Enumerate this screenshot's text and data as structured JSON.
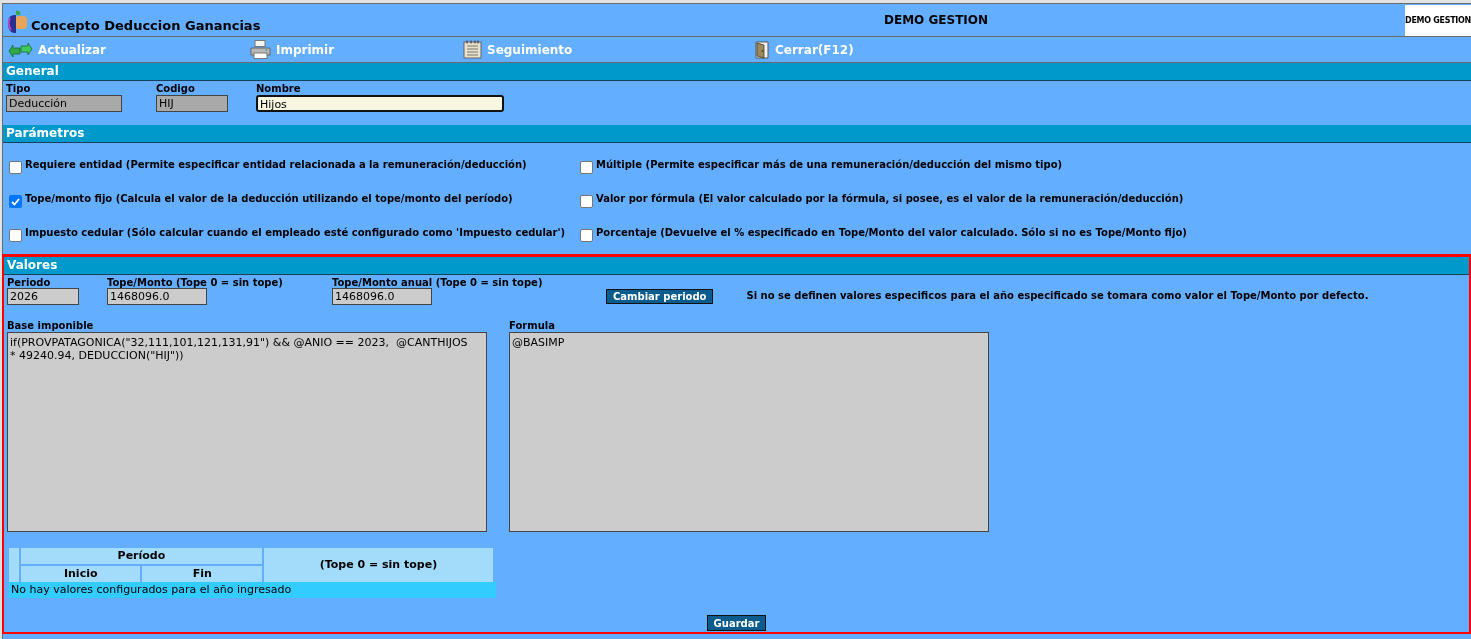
{
  "window": {
    "title": "Concepto Deduccion Ganancias",
    "company": "DEMO GESTION",
    "logo_text": "DEMO GESTION"
  },
  "toolbar": [
    {
      "label": "Actualizar"
    },
    {
      "label": "Imprimir"
    },
    {
      "label": "Seguimiento"
    },
    {
      "label": "Cerrar(F12)"
    }
  ],
  "general": {
    "title": "General",
    "fields": [
      {
        "label": "Tipo",
        "value": "Deducción",
        "disabled": true
      },
      {
        "label": "Codigo",
        "value": "HIJ",
        "disabled": true
      },
      {
        "label": "Nombre",
        "value": "Hijos",
        "disabled": false
      }
    ]
  },
  "parametros": {
    "title": "Parámetros",
    "options": [
      {
        "label": "Requiere entidad (Permite especificar entidad relacionada a la remuneración/deducción)",
        "checked": false
      },
      {
        "label": "Múltiple (Permite especificar más de una remuneración/deducción del mismo tipo)",
        "checked": false
      },
      {
        "label": "Tope/monto fijo (Calcula el valor de la deducción utilizando el tope/monto del período)",
        "checked": true
      },
      {
        "label": "Valor por fórmula (El valor calculado por la fórmula, si posee, es el valor de la remuneración/deducción)",
        "checked": false
      },
      {
        "label": "Impuesto cedular (Sólo calcular cuando el empleado esté configurado como 'Impuesto cedular')",
        "checked": false
      },
      {
        "label": "Porcentaje (Devuelve el % especificado en Tope/Monto del valor calculado. Sólo si no es Tope/Monto fijo)",
        "checked": false
      }
    ]
  },
  "valores": {
    "title": "Valores",
    "fields": [
      {
        "label": "Periodo",
        "value": "2026"
      },
      {
        "label": "Tope/Monto (Tope 0 = sin tope)",
        "value": "1468096.0"
      },
      {
        "label": "Tope/Monto anual (Tope 0 = sin tope)",
        "value": "1468096.0"
      }
    ],
    "change_button": "Cambiar periodo",
    "note": "Si no se definen valores especificos para el año especificado se tomara como valor el Tope/Monto por defecto.",
    "base_imponible": {
      "label": "Base imponible",
      "value": "if(PROVPATAGONICA(\"32,111,101,121,131,91\") && @ANIO == 2023,  @CANTHIJOS * 49240.94, DEDUCCION(\"HIJ\"))"
    },
    "formula": {
      "label": "Formula",
      "value": "@BASIMP"
    },
    "table": {
      "column_groups": [
        {
          "label": "Período",
          "columns": [
            "Inicio",
            "Fin"
          ]
        },
        {
          "label": "(Tope 0 = sin tope)"
        }
      ],
      "empty_message": "No hay valores configurados para el año ingresado"
    },
    "save_button": "Guardar"
  }
}
